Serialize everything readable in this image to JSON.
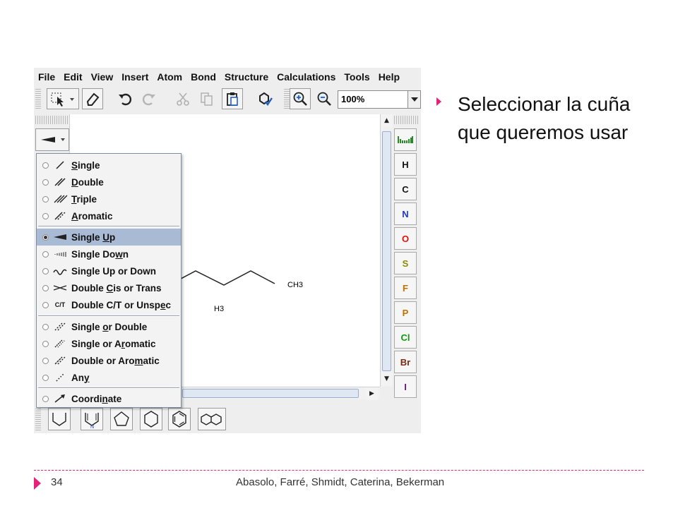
{
  "menu": [
    "File",
    "Edit",
    "View",
    "Insert",
    "Atom",
    "Bond",
    "Structure",
    "Calculations",
    "Tools",
    "Help"
  ],
  "zoom": "100%",
  "elements": [
    "H",
    "C",
    "N",
    "O",
    "S",
    "F",
    "P",
    "Cl",
    "Br",
    "I"
  ],
  "element_colors": {
    "H": "#111111",
    "C": "#111111",
    "N": "#2038c8",
    "O": "#e01010",
    "S": "#8a8a00",
    "F": "#c07000",
    "P": "#c07000",
    "Cl": "#109a10",
    "Br": "#7a2a10",
    "I": "#6a1a8a"
  },
  "molecule": {
    "label1": "CH3",
    "label2": "H3"
  },
  "bond_menu": {
    "items": [
      {
        "pre": "",
        "acc": "S",
        "post": "ingle",
        "icon": "single-bond-icon",
        "selected": false
      },
      {
        "pre": "",
        "acc": "D",
        "post": "ouble",
        "icon": "double-bond-icon",
        "selected": false
      },
      {
        "pre": "",
        "acc": "T",
        "post": "riple",
        "icon": "triple-bond-icon",
        "selected": false
      },
      {
        "pre": "",
        "acc": "A",
        "post": "romatic",
        "icon": "aromatic-bond-icon",
        "selected": false
      },
      {
        "pre": "Single ",
        "acc": "U",
        "post": "p",
        "icon": "wedge-up-icon",
        "selected": true
      },
      {
        "pre": "Single Do",
        "acc": "w",
        "post": "n",
        "icon": "hash-down-icon",
        "selected": false
      },
      {
        "pre": "Single Up or Down",
        "acc": "",
        "post": "",
        "icon": "wavy-bond-icon",
        "selected": false
      },
      {
        "pre": "Double ",
        "acc": "C",
        "post": "is or Trans",
        "icon": "cross-bond-icon",
        "selected": false
      },
      {
        "pre": "Double C/T or Unsp",
        "acc": "e",
        "post": "c",
        "icon": "ct-label-icon",
        "selected": false
      },
      {
        "pre": "Single ",
        "acc": "o",
        "post": "r Double",
        "icon": "single-or-double-icon",
        "selected": false
      },
      {
        "pre": "Single or A",
        "acc": "r",
        "post": "omatic",
        "icon": "single-or-aromatic-icon",
        "selected": false
      },
      {
        "pre": "Double or Aro",
        "acc": "m",
        "post": "atic",
        "icon": "double-or-aromatic-icon",
        "selected": false
      },
      {
        "pre": "An",
        "acc": "y",
        "post": "",
        "icon": "any-bond-icon",
        "selected": false
      },
      {
        "pre": "Coordi",
        "acc": "n",
        "post": "ate",
        "icon": "coordinate-bond-icon",
        "selected": false
      }
    ],
    "ct_label": "C/T"
  },
  "bullet": "Seleccionar la cuña que queremos usar",
  "footer": {
    "page": "34",
    "authors": "Abasolo, Farré, Shmidt, Caterina, Bekerman"
  },
  "accent_color": "#e8207a",
  "selection_color": "#a8bad4"
}
